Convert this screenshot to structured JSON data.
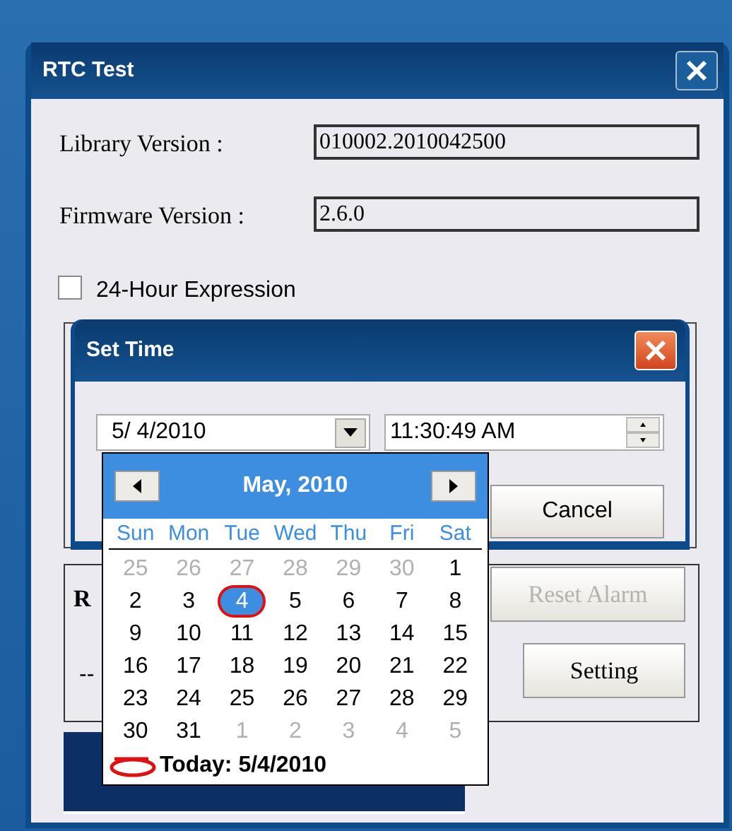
{
  "window": {
    "title": "RTC Test"
  },
  "fields": [
    {
      "label": "Library Version :",
      "value": "010002.2010042500"
    },
    {
      "label": "Firmware Version :",
      "value": "2.6.0"
    }
  ],
  "hour24_checkbox": {
    "label": "24-Hour Expression",
    "checked": false
  },
  "alarm_group": {
    "label": "R",
    "value": "--"
  },
  "buttons": [
    {
      "label": "Reset Alarm",
      "disabled": true
    },
    {
      "label": "Setting",
      "disabled": false
    }
  ],
  "dialog": {
    "title": "Set Time",
    "date_value": "5/ 4/2010",
    "time_value": "11:30:49 AM",
    "cancel_label": "Cancel"
  },
  "calendar": {
    "month_title": "May, 2010",
    "weekdays": [
      "Sun",
      "Mon",
      "Tue",
      "Wed",
      "Thu",
      "Fri",
      "Sat"
    ],
    "days": [
      {
        "label": "25",
        "in_month": false,
        "selected": false
      },
      {
        "label": "26",
        "in_month": false,
        "selected": false
      },
      {
        "label": "27",
        "in_month": false,
        "selected": false
      },
      {
        "label": "28",
        "in_month": false,
        "selected": false
      },
      {
        "label": "29",
        "in_month": false,
        "selected": false
      },
      {
        "label": "30",
        "in_month": false,
        "selected": false
      },
      {
        "label": "1",
        "in_month": true,
        "selected": false
      },
      {
        "label": "2",
        "in_month": true,
        "selected": false
      },
      {
        "label": "3",
        "in_month": true,
        "selected": false
      },
      {
        "label": "4",
        "in_month": true,
        "selected": true
      },
      {
        "label": "5",
        "in_month": true,
        "selected": false
      },
      {
        "label": "6",
        "in_month": true,
        "selected": false
      },
      {
        "label": "7",
        "in_month": true,
        "selected": false
      },
      {
        "label": "8",
        "in_month": true,
        "selected": false
      },
      {
        "label": "9",
        "in_month": true,
        "selected": false
      },
      {
        "label": "10",
        "in_month": true,
        "selected": false
      },
      {
        "label": "11",
        "in_month": true,
        "selected": false
      },
      {
        "label": "12",
        "in_month": true,
        "selected": false
      },
      {
        "label": "13",
        "in_month": true,
        "selected": false
      },
      {
        "label": "14",
        "in_month": true,
        "selected": false
      },
      {
        "label": "15",
        "in_month": true,
        "selected": false
      },
      {
        "label": "16",
        "in_month": true,
        "selected": false
      },
      {
        "label": "17",
        "in_month": true,
        "selected": false
      },
      {
        "label": "18",
        "in_month": true,
        "selected": false
      },
      {
        "label": "19",
        "in_month": true,
        "selected": false
      },
      {
        "label": "20",
        "in_month": true,
        "selected": false
      },
      {
        "label": "21",
        "in_month": true,
        "selected": false
      },
      {
        "label": "22",
        "in_month": true,
        "selected": false
      },
      {
        "label": "23",
        "in_month": true,
        "selected": false
      },
      {
        "label": "24",
        "in_month": true,
        "selected": false
      },
      {
        "label": "25",
        "in_month": true,
        "selected": false
      },
      {
        "label": "26",
        "in_month": true,
        "selected": false
      },
      {
        "label": "27",
        "in_month": true,
        "selected": false
      },
      {
        "label": "28",
        "in_month": true,
        "selected": false
      },
      {
        "label": "29",
        "in_month": true,
        "selected": false
      },
      {
        "label": "30",
        "in_month": true,
        "selected": false
      },
      {
        "label": "31",
        "in_month": true,
        "selected": false
      },
      {
        "label": "1",
        "in_month": false,
        "selected": false
      },
      {
        "label": "2",
        "in_month": false,
        "selected": false
      },
      {
        "label": "3",
        "in_month": false,
        "selected": false
      },
      {
        "label": "4",
        "in_month": false,
        "selected": false
      },
      {
        "label": "5",
        "in_month": false,
        "selected": false
      }
    ],
    "today_label": "Today: 5/4/2010"
  }
}
